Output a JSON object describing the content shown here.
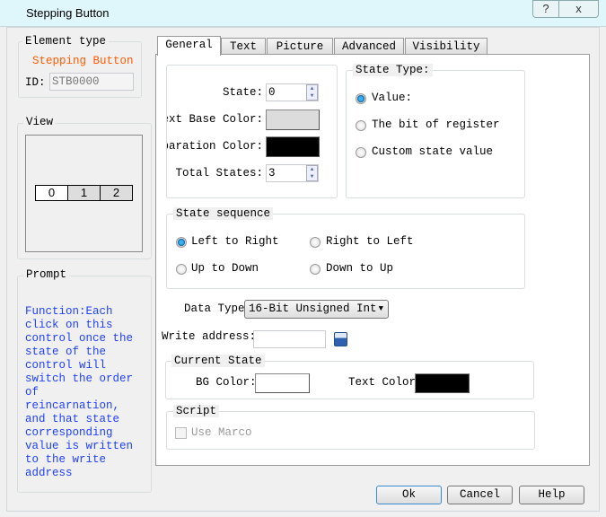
{
  "window": {
    "title": "Stepping Button",
    "help_icon": "?",
    "close_icon": "x"
  },
  "element_type": {
    "legend": "Element type",
    "name": "Stepping Button",
    "name_color": "#ff5a00",
    "id_label": "ID:",
    "id_value": "STB0000"
  },
  "view": {
    "legend": "View",
    "cells": [
      "0",
      "1",
      "2"
    ]
  },
  "prompt": {
    "legend": "Prompt",
    "text": "Function:Each click on this control once the state of the control will switch the order of reincarnation, and that state corresponding value is written to the write address",
    "text_color": "#2040ff"
  },
  "tabs": [
    {
      "label": "General"
    },
    {
      "label": "Text"
    },
    {
      "label": "Picture"
    },
    {
      "label": "Advanced"
    },
    {
      "label": "Visibility"
    }
  ],
  "general": {
    "state_label": "State:",
    "state_value": "0",
    "text_base_color_label": "ext Base Color:",
    "text_base_color": "#dcdcdc",
    "separation_color_label": "paration Color:",
    "separation_color": "#000000",
    "total_states_label": "Total States:",
    "total_states_value": "3",
    "state_type": {
      "legend": "State Type:",
      "options": [
        {
          "label": "Value:",
          "selected": true
        },
        {
          "label": "The bit of register",
          "selected": false
        },
        {
          "label": "Custom state value",
          "selected": false
        }
      ]
    },
    "state_sequence": {
      "legend": "State sequence",
      "options": [
        {
          "label": "Left to Right",
          "selected": true
        },
        {
          "label": "Right to Left",
          "selected": false
        },
        {
          "label": "Up to Down",
          "selected": false
        },
        {
          "label": "Down to Up",
          "selected": false
        }
      ]
    },
    "data_type_label": "Data Type:",
    "data_type_value": "16-Bit Unsigned Int",
    "write_address_label": "Write address:",
    "write_address_value": "",
    "current_state": {
      "legend": "Current State",
      "bg_color_label": "BG Color:",
      "bg_color": "#ffffff",
      "text_color_label": "Text Color:",
      "text_color": "#000000"
    },
    "script": {
      "legend": "Script",
      "use_marco_label": "Use Marco",
      "use_marco_checked": false
    }
  },
  "buttons": {
    "ok": "Ok",
    "cancel": "Cancel",
    "help": "Help"
  }
}
